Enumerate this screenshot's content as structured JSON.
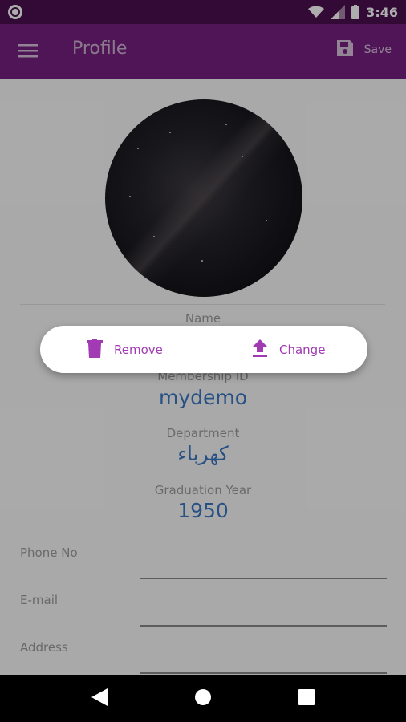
{
  "status_bar": {
    "time": "3:46"
  },
  "app_bar": {
    "title": "Profile",
    "save_label": "Save"
  },
  "profile": {
    "name_label": "Name",
    "membership_label": "Membership ID",
    "membership_value": "mydemo",
    "department_label": "Department",
    "department_value": "كهرباء",
    "graduation_label": "Graduation Year",
    "graduation_value": "1950"
  },
  "form": {
    "phone_label": "Phone No",
    "email_label": "E-mail",
    "address_label": "Address"
  },
  "popup": {
    "remove_label": "Remove",
    "change_label": "Change"
  },
  "colors": {
    "app_bar": "#761f81",
    "status_bar": "#4a0f4f",
    "value_text": "#3a78c4",
    "popup_accent": "#a23bb3"
  },
  "icons": [
    "menu-icon",
    "save-icon",
    "trash-icon",
    "upload-icon",
    "back-icon",
    "home-icon",
    "recents-icon",
    "wifi-icon",
    "signal-icon",
    "battery-icon"
  ]
}
